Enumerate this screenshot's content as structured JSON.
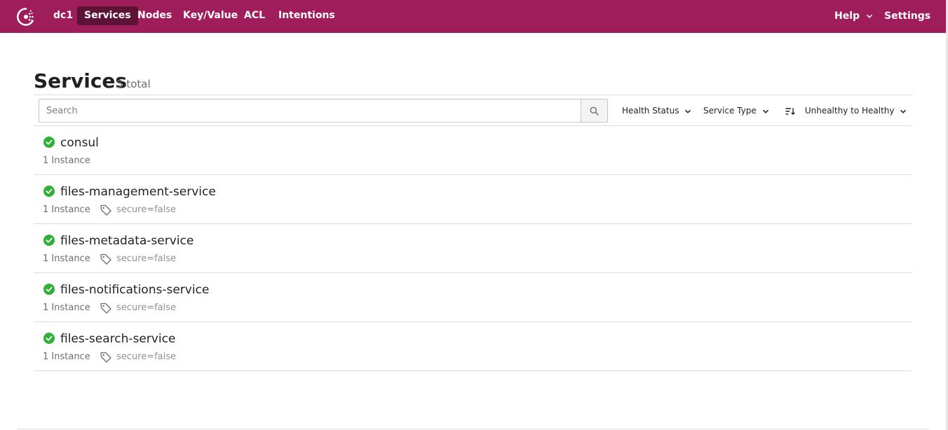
{
  "nav": {
    "datacenter": "dc1",
    "items": [
      {
        "label": "Services",
        "active": true
      },
      {
        "label": "Nodes",
        "active": false
      },
      {
        "label": "Key/Value",
        "active": false
      },
      {
        "label": "ACL",
        "active": false
      },
      {
        "label": "Intentions",
        "active": false
      }
    ],
    "help_label": "Help",
    "settings_label": "Settings"
  },
  "header": {
    "title": "Services",
    "count": "5 total"
  },
  "filters": {
    "search_placeholder": "Search",
    "search_value": "",
    "health_status_label": "Health Status",
    "service_type_label": "Service Type",
    "sort_label": "Unhealthy to Healthy"
  },
  "services": [
    {
      "name": "consul",
      "instances": "1 Instance",
      "tag": "",
      "health": "passing"
    },
    {
      "name": "files-management-service",
      "instances": "1 Instance",
      "tag": "secure=false",
      "health": "passing"
    },
    {
      "name": "files-metadata-service",
      "instances": "1 Instance",
      "tag": "secure=false",
      "health": "passing"
    },
    {
      "name": "files-notifications-service",
      "instances": "1 Instance",
      "tag": "secure=false",
      "health": "passing"
    },
    {
      "name": "files-search-service",
      "instances": "1 Instance",
      "tag": "secure=false",
      "health": "passing"
    }
  ],
  "colors": {
    "brand": "#a01d5b",
    "brand_active": "#5c1335",
    "passing": "#2eb039"
  },
  "icons": {
    "logo": "consul-logo-icon",
    "search": "search-icon",
    "chevron": "chevron-down-icon",
    "sort": "sort-icon",
    "health": "check-circle-icon",
    "tag": "tag-icon"
  }
}
